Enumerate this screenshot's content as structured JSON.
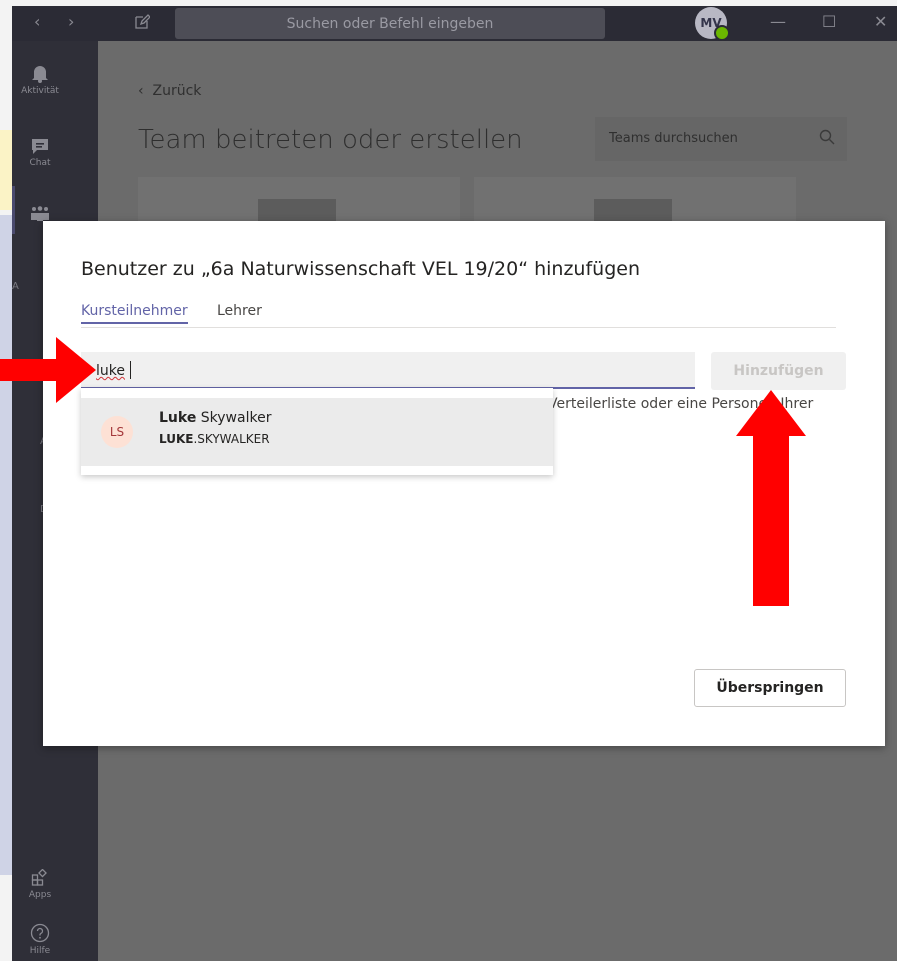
{
  "titlebar": {
    "search_placeholder": "Suchen oder Befehl eingeben",
    "avatar_initials": "MV",
    "back_glyph": "‹",
    "forward_glyph": "›",
    "minimize_glyph": "—",
    "maximize_glyph": "☐",
    "close_glyph": "✕"
  },
  "rail": {
    "items": [
      {
        "label": "Aktivität",
        "icon": "bell-icon"
      },
      {
        "label": "Chat",
        "icon": "chat-icon"
      },
      {
        "label": "",
        "icon": "teams-icon"
      }
    ],
    "bottom_items": [
      {
        "label": "Apps",
        "icon": "apps-icon"
      },
      {
        "label": "Hilfe",
        "icon": "help-icon"
      }
    ],
    "fragments": [
      "A",
      "A",
      "D"
    ]
  },
  "main": {
    "back_label": "Zurück",
    "title": "Team beitreten oder erstellen",
    "search_placeholder": "Teams durchsuchen"
  },
  "dialog": {
    "title": "Benutzer zu „6a Naturwissenschaft VEL 19/20“ hinzufügen",
    "tabs": [
      "Kursteilnehmer",
      "Lehrer"
    ],
    "search_value": "luke",
    "add_button": "Hinzufügen",
    "helper_text": "Verteilerliste oder eine Personen Ihrer",
    "suggestion": {
      "initials": "LS",
      "name_bold": "Luke",
      "name_rest": " Skywalker",
      "sub_bold": "LUKE",
      "sub_rest": ".SKYWALKER"
    },
    "skip_button": "Überspringen"
  },
  "colors": {
    "accent": "#6264a7",
    "arrow": "#ff0000"
  }
}
